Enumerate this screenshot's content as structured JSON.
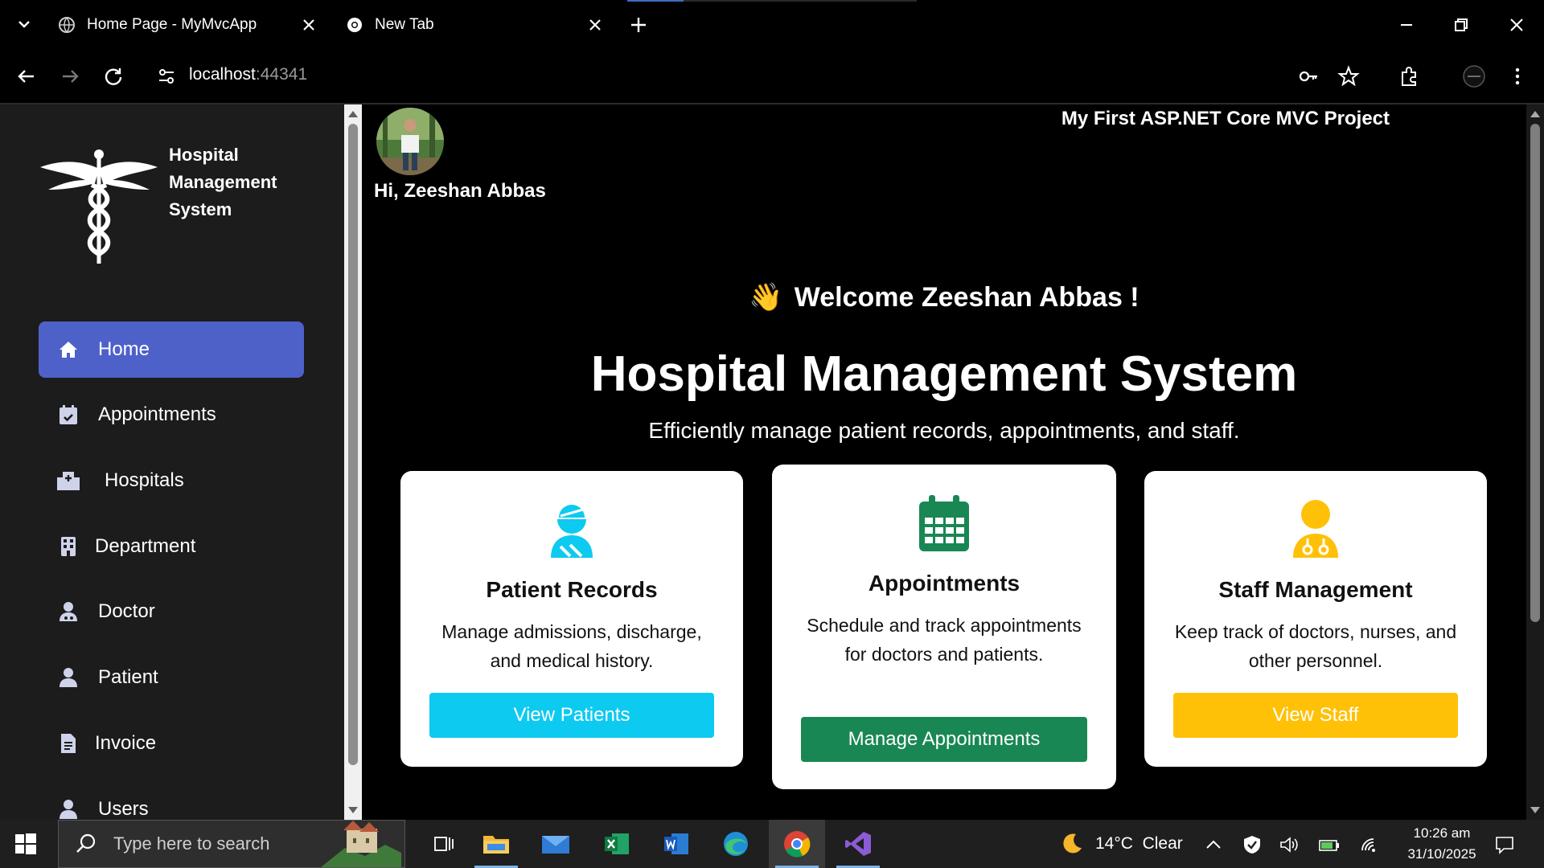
{
  "browser": {
    "tabs": [
      {
        "title": "Home Page - MyMvcApp"
      },
      {
        "title": "New Tab"
      }
    ],
    "url_host": "localhost",
    "url_port": ":44341"
  },
  "sidebar": {
    "brand": [
      "Hospital",
      "Management",
      "System"
    ],
    "items": [
      {
        "label": "Home",
        "icon": "home-icon",
        "active": true
      },
      {
        "label": "Appointments",
        "icon": "calendar-check-icon"
      },
      {
        "label": "Hospitals",
        "icon": "hospital-icon"
      },
      {
        "label": "Department",
        "icon": "building-icon"
      },
      {
        "label": "Doctor",
        "icon": "user-doctor-icon"
      },
      {
        "label": "Patient",
        "icon": "user-icon"
      },
      {
        "label": "Invoice",
        "icon": "file-invoice-icon"
      },
      {
        "label": "Users",
        "icon": "user-icon"
      }
    ]
  },
  "header": {
    "greeting": "Hi, Zeeshan Abbas",
    "project_title": "My First ASP.NET Core MVC Project"
  },
  "hero": {
    "welcome_emoji": "👋",
    "welcome": "Welcome Zeeshan Abbas !",
    "title": "Hospital Management System",
    "subtitle": "Efficiently manage patient records, appointments, and staff."
  },
  "cards": [
    {
      "title": "Patient Records",
      "desc": "Manage admissions, discharge, and medical history.",
      "button": "View Patients",
      "color": "#0dcaf0",
      "icon": "user-injured-icon"
    },
    {
      "title": "Appointments",
      "desc": "Schedule and track appointments for doctors and patients.",
      "button": "Manage Appointments",
      "color": "#198754",
      "icon": "calendar-icon"
    },
    {
      "title": "Staff Management",
      "desc": "Keep track of doctors, nurses, and other personnel.",
      "button": "View Staff",
      "color": "#ffc107",
      "icon": "user-nurse-icon"
    }
  ],
  "taskbar": {
    "search_placeholder": "Type here to search",
    "weather": "14°C  Clear",
    "time": "10:26 am",
    "date": "31/10/2025"
  },
  "colors": {
    "sidebar_bg": "#1c1c1c",
    "active_nav": "#4e61c9",
    "main_bg": "#000000"
  }
}
